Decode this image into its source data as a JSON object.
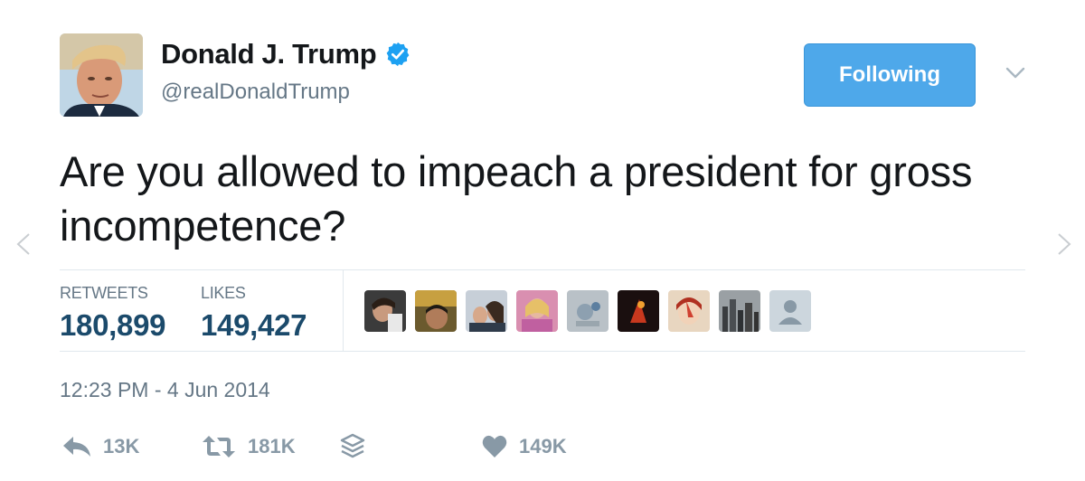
{
  "tweet": {
    "author": {
      "display_name": "Donald J. Trump",
      "handle": "@realDonaldTrump",
      "verified": true
    },
    "follow_button_label": "Following",
    "text": "Are you allowed to impeach a president for gross incompetence?",
    "stats": {
      "retweets_label": "RETWEETS",
      "retweets_value": "180,899",
      "likes_label": "LIKES",
      "likes_value": "149,427"
    },
    "timestamp": "12:23 PM - 4 Jun 2014",
    "actions": {
      "reply_count": "13K",
      "retweet_count": "181K",
      "like_count": "149K"
    }
  },
  "icons": {
    "verified": "verified-badge-icon",
    "caret": "chevron-down-icon",
    "reply": "reply-icon",
    "retweet": "retweet-icon",
    "stack": "buffer-stack-icon",
    "like": "heart-icon",
    "nav_prev": "chevron-left-icon",
    "nav_next": "chevron-right-icon"
  },
  "colors": {
    "accent": "#4ea8ea",
    "stat_value": "#1b4a6b",
    "muted": "#657786",
    "action": "#8899a6"
  }
}
